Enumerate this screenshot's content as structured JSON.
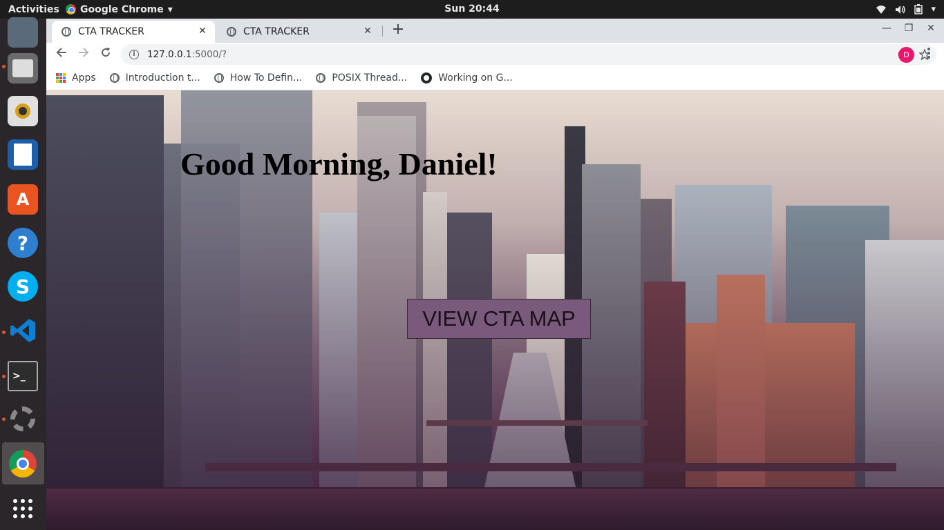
{
  "topbar": {
    "activities": "Activities",
    "app_name": "Google Chrome",
    "app_menu_arrow": "▾",
    "clock": "Sun 20:44",
    "tray_menu_arrow": "▾"
  },
  "dock": {
    "items": [
      {
        "name": "email-client-icon"
      },
      {
        "name": "file-manager-icon"
      },
      {
        "name": "music-player-icon"
      },
      {
        "name": "writer-document-icon"
      },
      {
        "name": "software-center-icon"
      },
      {
        "name": "help-icon"
      },
      {
        "name": "skype-icon"
      },
      {
        "name": "vscode-icon"
      },
      {
        "name": "terminal-icon"
      },
      {
        "name": "system-settings-icon"
      },
      {
        "name": "chrome-icon"
      },
      {
        "name": "show-apps-icon"
      }
    ]
  },
  "browser": {
    "tabs": [
      {
        "title": "CTA TRACKER",
        "active": true
      },
      {
        "title": "CTA TRACKER",
        "active": false
      }
    ],
    "tab_close": "✕",
    "new_tab": "+",
    "address": {
      "host": "127.0.0.1",
      "path": ":5000/?"
    },
    "profile_initial": "D",
    "bookmarks": [
      {
        "label": "Apps",
        "icon": "apps-grid-icon"
      },
      {
        "label": "Introduction t...",
        "icon": "globe-icon"
      },
      {
        "label": "How To Defin...",
        "icon": "globe-icon"
      },
      {
        "label": "POSIX Thread...",
        "icon": "globe-icon"
      },
      {
        "label": "Working on G...",
        "icon": "github-icon"
      }
    ]
  },
  "page": {
    "greeting": "Good Morning, Daniel!",
    "view_map_button": "VIEW CTA MAP"
  },
  "colors": {
    "button_bg": "#7a5a7c",
    "profile_avatar": "#e8176d",
    "ubuntu_orange": "#e95420"
  }
}
